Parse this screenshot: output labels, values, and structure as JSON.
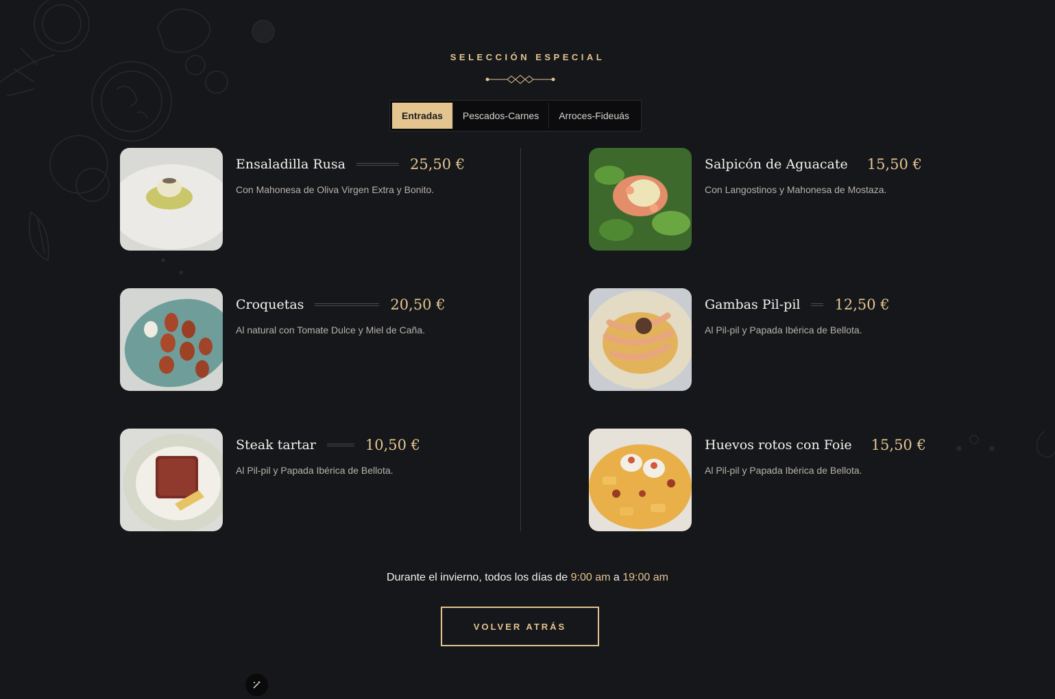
{
  "section": {
    "kicker": "SELECCIÓN ESPECIAL"
  },
  "tabs": [
    {
      "label": "Entradas",
      "active": true
    },
    {
      "label": "Pescados-Carnes",
      "active": false
    },
    {
      "label": "Arroces-Fideuás",
      "active": false
    }
  ],
  "menu": {
    "left": [
      {
        "name": "Ensaladilla Rusa",
        "price": "25,50 €",
        "description": "Con Mahonesa de Oliva Virgen Extra y Bonito."
      },
      {
        "name": "Croquetas",
        "price": "20,50 €",
        "description": "Al natural con Tomate Dulce y Miel de Caña."
      },
      {
        "name": "Steak tartar",
        "price": "10,50 €",
        "description": "Al Pil-pil y Papada Ibérica de Bellota."
      }
    ],
    "right": [
      {
        "name": "Salpicón de Aguacate",
        "price": "15,50 €",
        "description": "Con Langostinos y Mahonesa de Mostaza."
      },
      {
        "name": "Gambas Pil-pil",
        "price": "12,50 €",
        "description": "Al Pil-pil y Papada Ibérica de Bellota."
      },
      {
        "name": "Huevos rotos con Foie",
        "price": "15,50 €",
        "description": "Al Pil-pil y Papada Ibérica de Bellota."
      }
    ]
  },
  "hours": {
    "prefix": "Durante el invierno, todos los días de",
    "start": "9:00 am",
    "connector": "a",
    "end": "19:00 am"
  },
  "back_button": {
    "label": "VOLVER ATRÁS"
  },
  "colors": {
    "background": "#16171a",
    "accent_gold": "#e4c590",
    "text": "#f5f3ee",
    "muted_text": "#b7b3ab"
  },
  "icons": {
    "ornament": "diamond-divider-icon",
    "edit": "magic-wand-icon"
  }
}
